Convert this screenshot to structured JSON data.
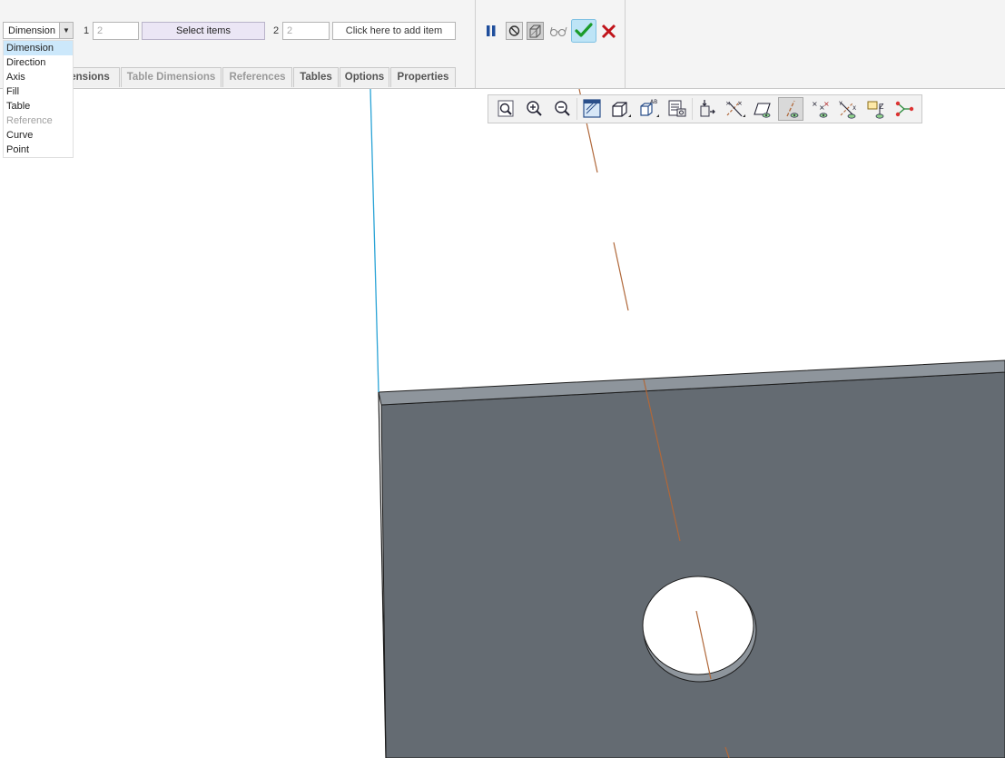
{
  "dashboard": {
    "type_dropdown": {
      "value": "Dimension"
    },
    "ref1": {
      "label": "1",
      "value": "2",
      "button_label": "Select items"
    },
    "ref2": {
      "label": "2",
      "value": "2",
      "button_label": "Click here to add item"
    },
    "tabs": [
      {
        "label": "ensions",
        "active": true
      },
      {
        "label": "Table Dimensions",
        "active": false
      },
      {
        "label": "References",
        "active": false
      },
      {
        "label": "Tables",
        "active": true
      },
      {
        "label": "Options",
        "active": true
      },
      {
        "label": "Properties",
        "active": true
      }
    ],
    "controls": {
      "pause_icon": "pause-icon",
      "stop_icon": "no-icon",
      "preview_icon": "preview-box-icon",
      "verify_icon": "glasses-icon",
      "ok_icon": "check-icon",
      "cancel_icon": "close-icon",
      "ok_color": "#1a9b2a",
      "cancel_color": "#c0141b"
    }
  },
  "dropdown_list": {
    "items": [
      {
        "label": "Dimension",
        "state": "selected"
      },
      {
        "label": "Direction",
        "state": "normal"
      },
      {
        "label": "Axis",
        "state": "normal"
      },
      {
        "label": "Fill",
        "state": "normal"
      },
      {
        "label": "Table",
        "state": "normal"
      },
      {
        "label": "Reference",
        "state": "disabled"
      },
      {
        "label": "Curve",
        "state": "normal"
      },
      {
        "label": "Point",
        "state": "normal"
      }
    ]
  },
  "graphics_toolbar": {
    "buttons": [
      {
        "icon": "refit-icon",
        "pressed": false
      },
      {
        "icon": "zoom-in-icon",
        "pressed": false
      },
      {
        "icon": "zoom-out-icon",
        "pressed": false
      },
      {
        "icon": "repaint-icon",
        "pressed": false
      },
      {
        "icon": "display-style-icon",
        "pressed": false
      },
      {
        "icon": "saved-orientations-icon",
        "pressed": false
      },
      {
        "icon": "view-manager-icon",
        "pressed": false
      },
      {
        "icon": "perspective-view-icon",
        "pressed": false
      },
      {
        "icon": "annotation-display-icon",
        "pressed": false
      },
      {
        "icon": "plane-display-icon",
        "pressed": false
      },
      {
        "icon": "axis-display-icon",
        "pressed": true
      },
      {
        "icon": "point-display-icon",
        "pressed": false
      },
      {
        "icon": "csys-display-icon",
        "pressed": false
      },
      {
        "icon": "spin-center-icon",
        "pressed": false
      },
      {
        "icon": "datum-display-filters-icon",
        "pressed": false
      }
    ]
  },
  "colors": {
    "part_face": "#646b72",
    "axis_line": "#b0683a",
    "edge_highlight": "#2aa3d6"
  }
}
